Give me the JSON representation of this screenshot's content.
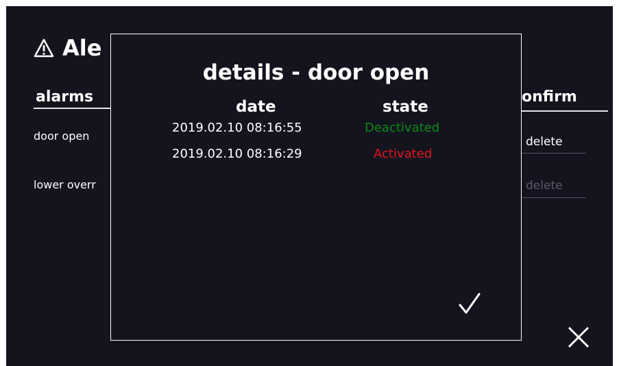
{
  "background": {
    "title": "Ale",
    "col_alarms": "alarms",
    "col_confirm": "onfirm",
    "rows": [
      {
        "name": "door open",
        "action": "delete"
      },
      {
        "name": "lower overr",
        "action": "delete"
      }
    ]
  },
  "modal": {
    "title": "details - door open",
    "col_date": "date",
    "col_state": "state",
    "entries": [
      {
        "date": "2019.02.10  08:16:55",
        "state": "Deactivated",
        "state_color": "#0e8a16"
      },
      {
        "date": "2019.02.10  08:16:29",
        "state": "Activated",
        "state_color": "#e0151b"
      }
    ]
  },
  "icons": {
    "alert": "warning-icon",
    "close": "close-icon",
    "confirm": "checkmark-icon"
  },
  "colors": {
    "background": "#14141f",
    "text": "#ffffff",
    "deactivated": "#0e8a16",
    "activated": "#e0151b",
    "disabled": "#5a5a6a"
  }
}
